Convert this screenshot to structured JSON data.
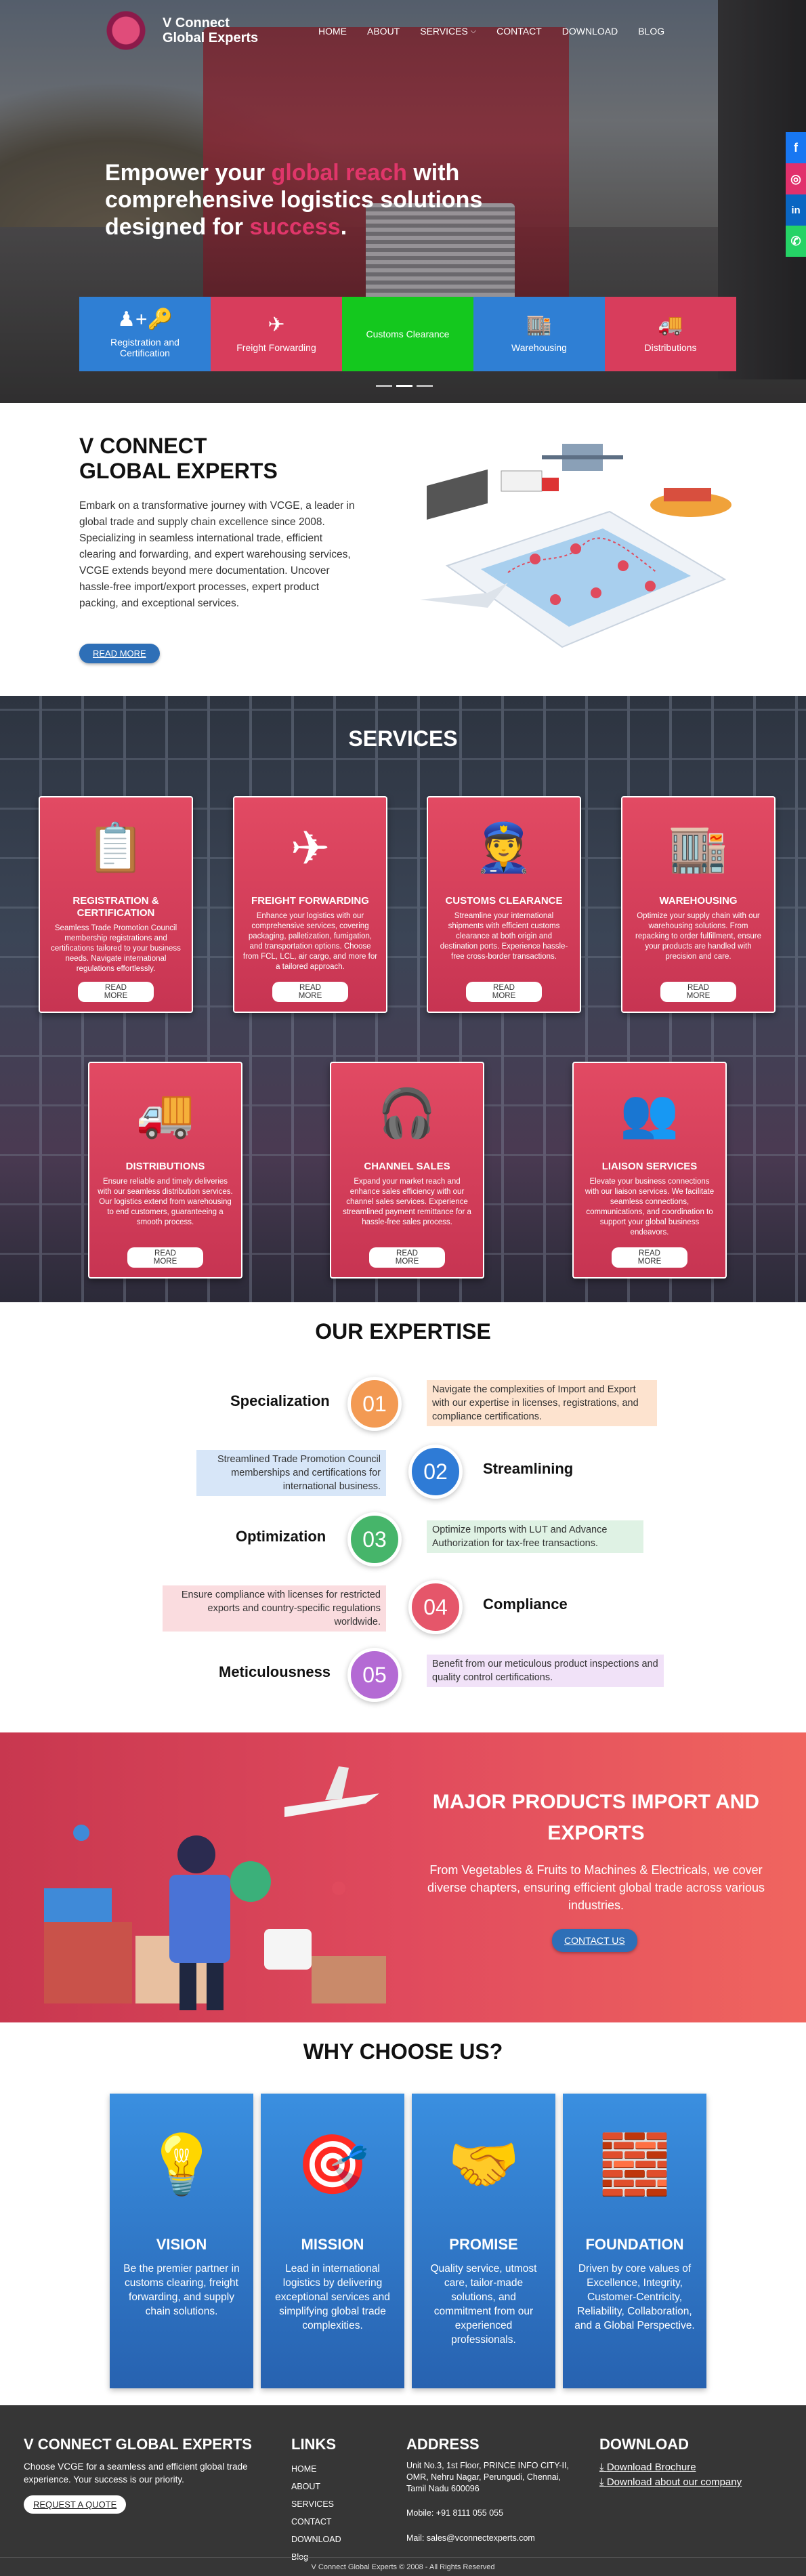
{
  "brand": {
    "line1": "V Connect",
    "line2": "Global Experts"
  },
  "nav": {
    "home": "HOME",
    "about": "ABOUT",
    "services": "SERVICES",
    "contact": "CONTACT",
    "download": "DOWNLOAD",
    "blog": "BLOG"
  },
  "hero": {
    "title_pre": "Empower your ",
    "title_hl1": "global reach",
    "title_mid": " with comprehensive logistics solutions designed for ",
    "title_hl2": "success",
    "title_end": ".",
    "cards": [
      {
        "label": "Registration and Certification",
        "icon": "person-add-key-icon",
        "color": "#2f7fd4"
      },
      {
        "label": "Freight Forwarding",
        "icon": "airplane-icon",
        "color": "#d83d5c"
      },
      {
        "label": "Customs Clearance",
        "icon": "",
        "color": "#14c81e"
      },
      {
        "label": "Warehousing",
        "icon": "warehouse-icon",
        "color": "#2f7fd4"
      },
      {
        "label": "Distributions",
        "icon": "truck-icon",
        "color": "#d83d5c"
      }
    ]
  },
  "social": [
    {
      "name": "facebook-icon",
      "glyph": "f",
      "color": "#1877f2"
    },
    {
      "name": "instagram-icon",
      "glyph": "◎",
      "color": "#e1306c"
    },
    {
      "name": "linkedin-icon",
      "glyph": "in",
      "color": "#0a66c2"
    },
    {
      "name": "whatsapp-icon",
      "glyph": "✆",
      "color": "#25d366"
    }
  ],
  "about": {
    "title1": "V CONNECT",
    "title2": "GLOBAL EXPERTS",
    "text": "Embark on a transformative journey with VCGE, a leader in global trade and supply chain excellence since 2008. Specializing in seamless international trade, efficient clearing and forwarding, and expert warehousing services, VCGE extends beyond mere documentation. Uncover hassle-free import/export processes, expert product packing, and exceptional services.",
    "button": "READ MORE"
  },
  "services": {
    "title": "SERVICES",
    "read_more": "READ MORE",
    "items": [
      {
        "title": "REGISTRATION & CERTIFICATION",
        "text": "Seamless Trade Promotion Council membership registrations and certifications tailored to your business needs. Navigate international regulations effortlessly.",
        "icon": "certificate-icon",
        "glyph": "📋"
      },
      {
        "title": "FREIGHT FORWARDING",
        "text": "Enhance your logistics with our comprehensive services, covering packaging, palletization, fumigation, and transportation options. Choose from FCL, LCL, air cargo, and more for a tailored approach.",
        "icon": "freight-icon",
        "glyph": "✈"
      },
      {
        "title": "CUSTOMS CLEARANCE",
        "text": "Streamline your international shipments with efficient customs clearance at both origin and destination ports. Experience hassle-free cross-border transactions.",
        "icon": "customs-officer-icon",
        "glyph": "👮"
      },
      {
        "title": "WAREHOUSING",
        "text": "Optimize your supply chain with our warehousing solutions. From repacking to order fulfillment, ensure your products are handled with precision and care.",
        "icon": "warehouse-icon",
        "glyph": "🏬"
      },
      {
        "title": "DISTRIBUTIONS",
        "text": "Ensure reliable and timely deliveries with our seamless distribution services. Our logistics extend from warehousing to end customers, guaranteeing a smooth process.",
        "icon": "distribution-icon",
        "glyph": "🚚"
      },
      {
        "title": "CHANNEL SALES",
        "text": "Expand your market reach and enhance sales efficiency with our channel sales services. Experience streamlined payment remittance for a hassle-free sales process.",
        "icon": "headset-icon",
        "glyph": "🎧"
      },
      {
        "title": "LIAISON SERVICES",
        "text": "Elevate your business connections with our liaison services. We facilitate seamless connections, communications, and coordination to support your global business endeavors.",
        "icon": "team-icon",
        "glyph": "👥"
      }
    ]
  },
  "expertise": {
    "title": "OUR EXPERTISE",
    "items": [
      {
        "num": "01",
        "label": "Specialization",
        "desc": "Navigate the complexities of Import and Export with our expertise in licenses, registrations, and compliance certifications.",
        "color": "#f39a53",
        "bg": "#fde3cf"
      },
      {
        "num": "02",
        "label": "Streamlining",
        "desc": "Streamlined Trade Promotion Council memberships and certifications for international business.",
        "color": "#2e7bd6",
        "bg": "#d7e6f8"
      },
      {
        "num": "03",
        "label": "Optimization",
        "desc": "Optimize Imports with LUT and Advance Authorization for tax-free transactions.",
        "color": "#46b56a",
        "bg": "#dff2e4"
      },
      {
        "num": "04",
        "label": "Compliance",
        "desc": "Ensure compliance with licenses for restricted exports and country-specific regulations worldwide.",
        "color": "#e5566a",
        "bg": "#fadcdf"
      },
      {
        "num": "05",
        "label": "Meticulousness",
        "desc": "Benefit from our meticulous product inspections and quality control certifications.",
        "color": "#b46ad4",
        "bg": "#f1e2f8"
      }
    ]
  },
  "products": {
    "title": "MAJOR PRODUCTS IMPORT AND EXPORTS",
    "text": "From Vegetables & Fruits to Machines & Electricals, we cover diverse chapters, ensuring efficient global trade across various industries.",
    "button": "CONTACT US"
  },
  "why": {
    "title": "WHY CHOOSE US?",
    "items": [
      {
        "title": "VISION",
        "text": "Be the premier partner in customs clearing, freight forwarding, and supply chain solutions.",
        "icon": "lightbulb-icon",
        "glyph": "💡"
      },
      {
        "title": "MISSION",
        "text": "Lead in international logistics by delivering exceptional services and simplifying global trade complexities.",
        "icon": "target-icon",
        "glyph": "🎯"
      },
      {
        "title": "PROMISE",
        "text": "Quality service, utmost care, tailor-made solutions, and commitment from our experienced professionals.",
        "icon": "handshake-icon",
        "glyph": "🤝"
      },
      {
        "title": "FOUNDATION",
        "text": "Driven by core values of Excellence, Integrity, Customer-Centricity, Reliability, Collaboration, and a Global Perspective.",
        "icon": "bricks-icon",
        "glyph": "🧱"
      }
    ]
  },
  "footer": {
    "brand_title": "V CONNECT GLOBAL EXPERTS",
    "brand_text": "Choose VCGE for a seamless and efficient global trade experience. Your success is our priority.",
    "quote_button": "REQUEST A QUOTE",
    "links_title": "LINKS",
    "links": [
      "HOME",
      "ABOUT",
      "SERVICES",
      "CONTACT",
      "DOWNLOAD",
      "Blog"
    ],
    "address_title": "ADDRESS",
    "address": "Unit No.3, 1st Floor, PRINCE INFO CITY-II, OMR, Nehru Nagar, Perungudi, Chennai, Tamil Nadu 600096",
    "mobile": "Mobile: +91 8111 055 055",
    "mail": "Mail: sales@vconnectexperts.com",
    "download_title": "DOWNLOAD",
    "download_brochure": "Download Brochure",
    "download_company": "Download about our company",
    "copyright": "V Connect Global Experts © 2008 - All Rights Reserved"
  }
}
